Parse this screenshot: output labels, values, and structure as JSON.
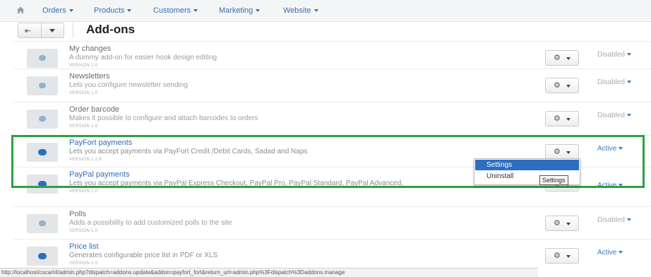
{
  "nav": {
    "items": [
      {
        "label": "Orders"
      },
      {
        "label": "Products"
      },
      {
        "label": "Customers"
      },
      {
        "label": "Marketing"
      },
      {
        "label": "Website"
      }
    ]
  },
  "toolbar": {
    "title": "Add-ons"
  },
  "addons": [
    {
      "name": "My changes",
      "description": "A dummy add-on for easier hook design editing",
      "version": "VERSION 1.0",
      "status": "Disabled"
    },
    {
      "name": "Newsletters",
      "description": "Lets you configure newsletter sending",
      "version": "VERSION 1.0",
      "status": "Disabled"
    },
    {
      "name": "Order barcode",
      "description": "Makes it possible to configure and attach barcodes to orders",
      "version": "VERSION 1.0",
      "status": "Disabled"
    },
    {
      "name": "PayFort payments",
      "description": "Lets you accept payments via PayFort Credit /Debit Cards, Sadad and Naps",
      "version": "VERSION 1.2.8",
      "status": "Active"
    },
    {
      "name": "PayPal payments",
      "description": "Lets you accept payments via PayPal Express Checkout, PayPal Pro, PayPal Standard, PayPal Advanced,",
      "version": "VERSION 1.0",
      "status": "Active"
    },
    {
      "name": "Polls",
      "description": "Adds a possibility to add customized polls to the site",
      "version": "VERSION 1.0",
      "status": "Disabled"
    },
    {
      "name": "Price list",
      "description": "Generates configurable price list in PDF or XLS",
      "version": "VERSION 1.0",
      "status": "Active"
    }
  ],
  "dropdown": {
    "options": [
      {
        "label": "Settings"
      },
      {
        "label": "Uninstall"
      }
    ]
  },
  "tooltip": "Settings",
  "status_url": "http://localhost/cscart4/admin.php?dispatch=addons.update&addon=payfort_fort&return_url=admin.php%3Fdispatch%3Daddons.manage",
  "colors": {
    "highlight": "#2ea043",
    "link": "#2f6fb7",
    "menu_selected": "#2c6ec2"
  }
}
